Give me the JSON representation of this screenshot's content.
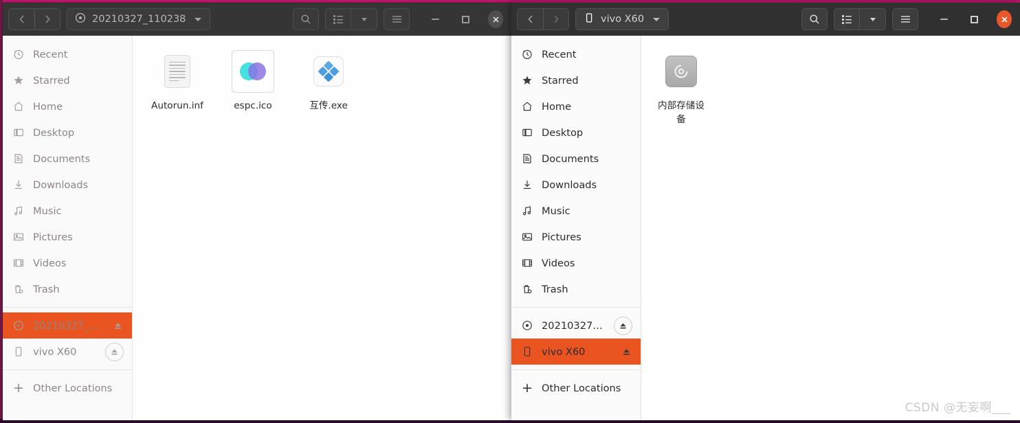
{
  "desktop": {
    "background_color": "#8e1b55",
    "accent_color": "#e95420"
  },
  "window_left": {
    "title": "20210327_110238",
    "active": false,
    "nav": {
      "back_label": "Back",
      "forward_label": "Forward"
    },
    "toolbar": {
      "search_label": "Search",
      "view_list_label": "List view",
      "view_dropdown_label": "View options",
      "menu_label": "Main menu",
      "minimize_label": "Minimize",
      "maximize_label": "Maximize",
      "close_label": "Close"
    },
    "sidebar": {
      "items": [
        {
          "label": "Recent",
          "icon": "clock-icon",
          "selected": false
        },
        {
          "label": "Starred",
          "icon": "star-icon",
          "selected": false
        },
        {
          "label": "Home",
          "icon": "home-icon",
          "selected": false
        },
        {
          "label": "Desktop",
          "icon": "desktop-icon",
          "selected": false
        },
        {
          "label": "Documents",
          "icon": "documents-icon",
          "selected": false
        },
        {
          "label": "Downloads",
          "icon": "downloads-icon",
          "selected": false
        },
        {
          "label": "Music",
          "icon": "music-icon",
          "selected": false
        },
        {
          "label": "Pictures",
          "icon": "pictures-icon",
          "selected": false
        },
        {
          "label": "Videos",
          "icon": "videos-icon",
          "selected": false
        },
        {
          "label": "Trash",
          "icon": "trash-icon",
          "selected": false
        }
      ],
      "devices": [
        {
          "label": "20210327_11…",
          "icon": "disc-icon",
          "selected": true,
          "eject": true,
          "eject_circled": false
        },
        {
          "label": "vivo X60",
          "icon": "phone-icon",
          "selected": false,
          "eject": true,
          "eject_circled": true
        }
      ],
      "other_locations": {
        "label": "Other Locations",
        "icon": "plus-icon"
      }
    },
    "files": [
      {
        "name": "Autorun.inf",
        "icon": "text-document-icon"
      },
      {
        "name": "espc.ico",
        "icon": "image-ico-icon"
      },
      {
        "name": "互传.exe",
        "icon": "executable-icon"
      }
    ]
  },
  "window_right": {
    "title": "vivo X60",
    "active": true,
    "nav": {
      "back_label": "Back",
      "forward_label": "Forward"
    },
    "toolbar": {
      "search_label": "Search",
      "view_list_label": "List view",
      "view_dropdown_label": "View options",
      "menu_label": "Main menu",
      "minimize_label": "Minimize",
      "maximize_label": "Maximize",
      "close_label": "Close"
    },
    "sidebar": {
      "items": [
        {
          "label": "Recent",
          "icon": "clock-icon",
          "selected": false
        },
        {
          "label": "Starred",
          "icon": "star-icon",
          "selected": false
        },
        {
          "label": "Home",
          "icon": "home-icon",
          "selected": false
        },
        {
          "label": "Desktop",
          "icon": "desktop-icon",
          "selected": false
        },
        {
          "label": "Documents",
          "icon": "documents-icon",
          "selected": false
        },
        {
          "label": "Downloads",
          "icon": "downloads-icon",
          "selected": false
        },
        {
          "label": "Music",
          "icon": "music-icon",
          "selected": false
        },
        {
          "label": "Pictures",
          "icon": "pictures-icon",
          "selected": false
        },
        {
          "label": "Videos",
          "icon": "videos-icon",
          "selected": false
        },
        {
          "label": "Trash",
          "icon": "trash-icon",
          "selected": false
        }
      ],
      "devices": [
        {
          "label": "20210327_11…",
          "icon": "disc-icon",
          "selected": false,
          "eject": true,
          "eject_circled": true
        },
        {
          "label": "vivo X60",
          "icon": "phone-icon",
          "selected": true,
          "eject": true,
          "eject_circled": false
        }
      ],
      "other_locations": {
        "label": "Other Locations",
        "icon": "plus-icon"
      }
    },
    "files": [
      {
        "name": "内部存储设备",
        "icon": "internal-storage-icon"
      }
    ]
  },
  "watermark": {
    "text": "CSDN @无妄啊___"
  }
}
